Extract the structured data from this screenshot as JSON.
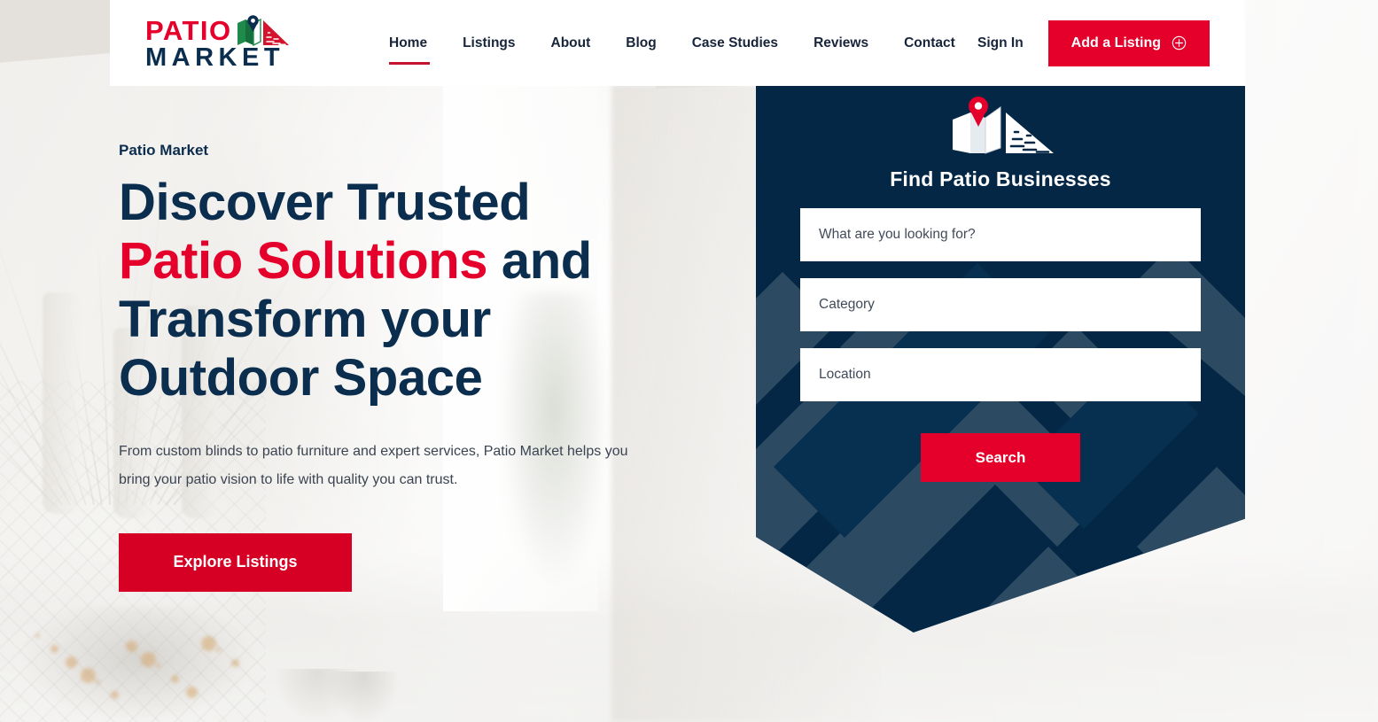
{
  "brand": {
    "name_line1": "PATIO",
    "name_line2": "MARKET",
    "logo_icon": "patio-market-map-pin-awning-logo",
    "accent_red": "#E4002B",
    "navy": "#042745",
    "deep_navy_text": "#0B2D4E"
  },
  "header": {
    "nav": [
      {
        "label": "Home",
        "active": true
      },
      {
        "label": "Listings",
        "active": false
      },
      {
        "label": "About",
        "active": false
      },
      {
        "label": "Blog",
        "active": false
      },
      {
        "label": "Case Studies",
        "active": false
      },
      {
        "label": "Reviews",
        "active": false
      },
      {
        "label": "Contact",
        "active": false
      }
    ],
    "sign_in_label": "Sign In",
    "add_listing_label": "Add a Listing",
    "add_listing_icon": "plus-circle-icon"
  },
  "hero": {
    "eyebrow": "Patio Market",
    "headline_line1": "Discover Trusted",
    "headline_highlight": "Patio Solutions",
    "headline_line2_tail": " and",
    "headline_line3": "Transform your",
    "headline_line4": "Outdoor Space",
    "paragraph": "From custom blinds to patio furniture and expert services, Patio Market helps you bring your patio vision to life with quality you can trust.",
    "cta_label": "Explore Listings"
  },
  "search_panel": {
    "icon": "map-pin-awning-icon",
    "title": "Find Patio Businesses",
    "fields": [
      {
        "name": "keyword",
        "placeholder": "What are you looking for?",
        "value": ""
      },
      {
        "name": "category",
        "placeholder": "Category",
        "value": ""
      },
      {
        "name": "location",
        "placeholder": "Location",
        "value": ""
      }
    ],
    "search_button_label": "Search"
  }
}
